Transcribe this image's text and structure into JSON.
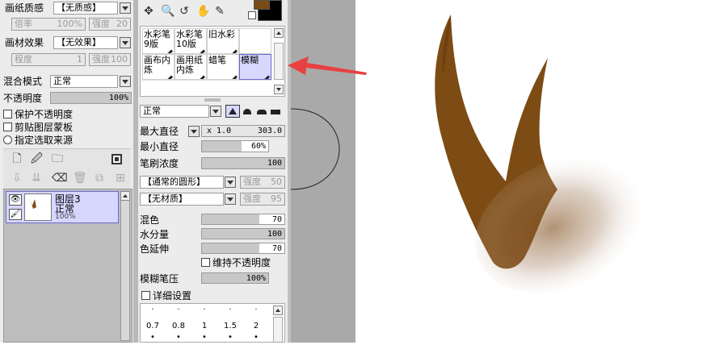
{
  "left_panel": {
    "paper_texture": {
      "label": "画纸质感",
      "value": "【无质感】"
    },
    "magnification": {
      "label": "倍率",
      "value": "100%"
    },
    "paper_strength": {
      "label": "强度",
      "value": "20"
    },
    "material_effect": {
      "label": "画材效果",
      "value": "【无效果】"
    },
    "degree": {
      "label": "程度",
      "value": "1"
    },
    "material_strength": {
      "label": "强度",
      "value": "100"
    },
    "blend_mode": {
      "label": "混合模式",
      "value": "正常"
    },
    "opacity": {
      "label": "不透明度",
      "value": "100%",
      "fraction": 1.0
    },
    "protect_opacity": "保护不透明度",
    "clipping_mask": "剪贴图层蒙板",
    "selection_source": "指定选取来源",
    "layer": {
      "name": "图层3",
      "mode": "正常",
      "opacity": "100%"
    }
  },
  "tool_panel": {
    "brushes": [
      {
        "label": "水彩笔9版"
      },
      {
        "label": "水彩笔10版"
      },
      {
        "label": "旧水彩"
      },
      {
        "label": ""
      },
      {
        "label": "画布内炼"
      },
      {
        "label": "画用纸内炼"
      },
      {
        "label": "蜡笔"
      },
      {
        "label": "模糊"
      }
    ],
    "blend": "正常",
    "max_diameter": {
      "label": "最大直径",
      "mult": "x 1.0",
      "value": "303.0"
    },
    "min_diameter": {
      "label": "最小直径",
      "value": "60%",
      "fraction": 0.6
    },
    "density": {
      "label": "笔刷浓度",
      "value": "100",
      "fraction": 1.0
    },
    "shape": {
      "value": "【通常的圆形】",
      "strength_label": "强度",
      "strength": "50"
    },
    "texture": {
      "value": "【无材质】",
      "strength_label": "强度",
      "strength": "95"
    },
    "mix": {
      "label": "混色",
      "value": "70",
      "fraction": 0.7
    },
    "water": {
      "label": "水分量",
      "value": "100",
      "fraction": 1.0
    },
    "color_stretch": {
      "label": "色延伸",
      "value": "70",
      "fraction": 0.7
    },
    "keep_opacity": "维持不透明度",
    "blur_pressure": {
      "label": "模糊笔压",
      "value": "100%",
      "fraction": 1.0
    },
    "advanced": "详细设置",
    "size_ticks": [
      "0.7",
      "0.8",
      "1",
      "1.5",
      "2"
    ]
  },
  "colors": {
    "foreground": "#7a4a12",
    "background": "#000000",
    "brown": "#7d4b14"
  }
}
